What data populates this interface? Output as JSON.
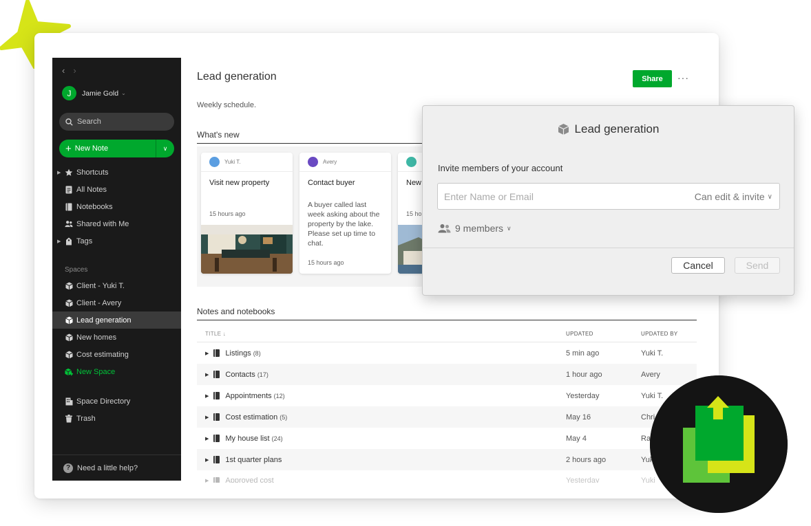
{
  "colors": {
    "brand_green": "#00a82d",
    "accent_lime": "#d6e418",
    "sidebar_bg": "#1a1a1a"
  },
  "sidebar": {
    "user_name": "Jamie Gold",
    "user_initial": "J",
    "search_label": "Search",
    "new_note_label": "New Note",
    "top_items": [
      {
        "label": "Shortcuts",
        "icon": "star-icon",
        "expandable": true
      },
      {
        "label": "All Notes",
        "icon": "note-icon",
        "expandable": false
      },
      {
        "label": "Notebooks",
        "icon": "notebook-icon",
        "expandable": false
      },
      {
        "label": "Shared with Me",
        "icon": "people-icon",
        "expandable": false
      },
      {
        "label": "Tags",
        "icon": "tag-icon",
        "expandable": true
      }
    ],
    "spaces_header": "Spaces",
    "spaces": [
      {
        "label": "Client - Yuki T.",
        "active": false
      },
      {
        "label": "Client - Avery",
        "active": false
      },
      {
        "label": "Lead generation",
        "active": true
      },
      {
        "label": "New homes",
        "active": false
      },
      {
        "label": "Cost estimating",
        "active": false
      }
    ],
    "new_space_label": "New Space",
    "space_directory_label": "Space Directory",
    "trash_label": "Trash",
    "help_label": "Need a little help?"
  },
  "main": {
    "title": "Lead generation",
    "share_label": "Share",
    "more_label": "···",
    "subtitle": "Weekly schedule.",
    "whats_new_heading": "What's new",
    "cards": [
      {
        "author": "Yuki T.",
        "author_color": "#5b9ee1",
        "title": "Visit new property",
        "time": "15 hours ago",
        "body": ""
      },
      {
        "author": "Avery",
        "author_color": "#6a4ac2",
        "title": "Contact buyer",
        "time": "15 hours ago",
        "body": "A buyer called last week asking about the property by the lake. Please set up time to chat."
      },
      {
        "author": "",
        "author_color": "#3fb8a6",
        "title": "New",
        "time": "15 ho",
        "body": ""
      }
    ],
    "notes_heading": "Notes and notebooks",
    "table": {
      "columns": [
        "TITLE ↓",
        "UPDATED",
        "UPDATED BY"
      ],
      "rows": [
        {
          "title": "Listings",
          "count": "(8)",
          "updated": "5 min ago",
          "by": "Yuki T."
        },
        {
          "title": "Contacts",
          "count": "(17)",
          "updated": "1 hour ago",
          "by": "Avery"
        },
        {
          "title": "Appointments",
          "count": "(12)",
          "updated": "Yesterday",
          "by": "Yuki T."
        },
        {
          "title": "Cost estimation",
          "count": "(5)",
          "updated": "May 16",
          "by": "Chri"
        },
        {
          "title": "My house list",
          "count": "(24)",
          "updated": "May 4",
          "by": "Ra"
        },
        {
          "title": "1st quarter plans",
          "count": "",
          "updated": "2 hours ago",
          "by": "Yuk"
        },
        {
          "title": "Approved cost",
          "count": "",
          "updated": "Yesterday",
          "by": "Yuki"
        }
      ]
    }
  },
  "dialog": {
    "title": "Lead generation",
    "invite_label": "Invite members of your account",
    "input_placeholder": "Enter Name or Email",
    "input_value": "",
    "permission": "Can edit & invite",
    "members": "9 members",
    "cancel_label": "Cancel",
    "send_label": "Send"
  }
}
